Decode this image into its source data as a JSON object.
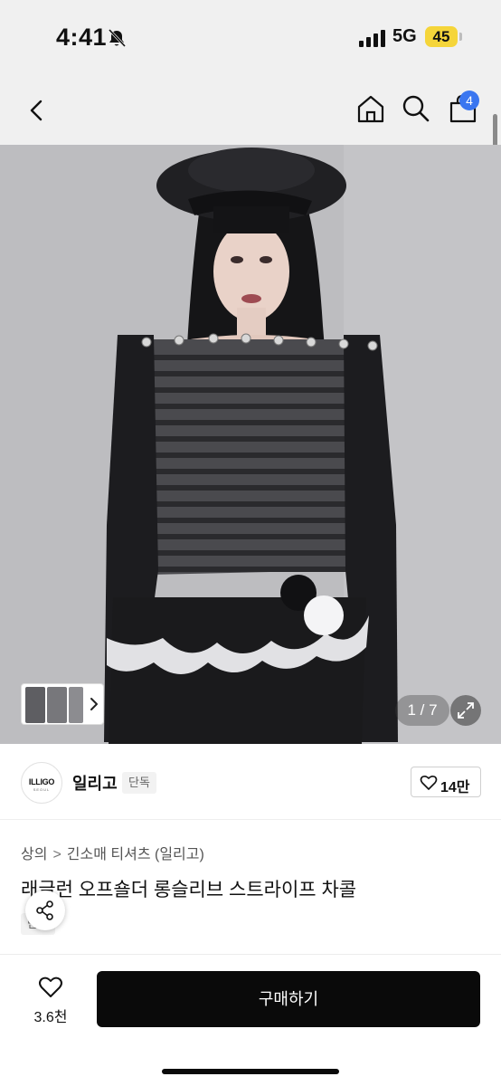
{
  "status_bar": {
    "time": "4:41",
    "network": "5G",
    "battery": "45",
    "icons": [
      "bell-slash-icon",
      "signal-icon"
    ]
  },
  "header": {
    "cart_count": "4",
    "icons": [
      "chevron-left-icon",
      "home-icon",
      "search-icon",
      "cart-icon"
    ]
  },
  "gallery": {
    "counter": "1 / 7",
    "icons": [
      "chevron-right-icon",
      "expand-icon"
    ]
  },
  "brand": {
    "logo_text": "ILLIGO",
    "logo_sub": "SEOUL",
    "name": "일리고",
    "tag": "단독",
    "likes": "14만"
  },
  "product": {
    "breadcrumb": [
      "상의",
      "긴소매 티셔츠 (일리고)"
    ],
    "title": "래글런 오프숄더 롱슬리브 스트라이프 차콜",
    "exclusive": "단독"
  },
  "bottom_bar": {
    "wish_count": "3.6천",
    "buy_label": "구매하기",
    "buy_color": "#0a0a0a"
  },
  "colors": {
    "accent_badge": "#3a76f0",
    "battery": "#f5d53a"
  }
}
